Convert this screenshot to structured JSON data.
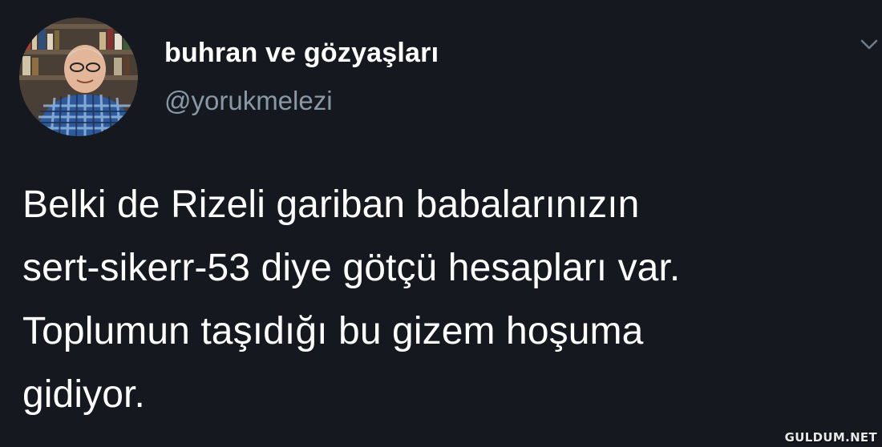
{
  "tweet": {
    "display_name": "buhran ve gözyaşları",
    "handle": "@yorukmelezi",
    "text_lines": [
      "Belki de Rizeli gariban babalarınızın",
      "sert-sikerr-53 diye götçü hesapları var.",
      "Toplumun taşıdığı bu gizem hoşuma",
      "gidiyor."
    ],
    "menu_icon": "chevron-down-icon"
  },
  "watermark": "GULDUM.NET",
  "colors": {
    "background": "#15181f",
    "text": "#ffffff",
    "handle": "#8899a6"
  }
}
